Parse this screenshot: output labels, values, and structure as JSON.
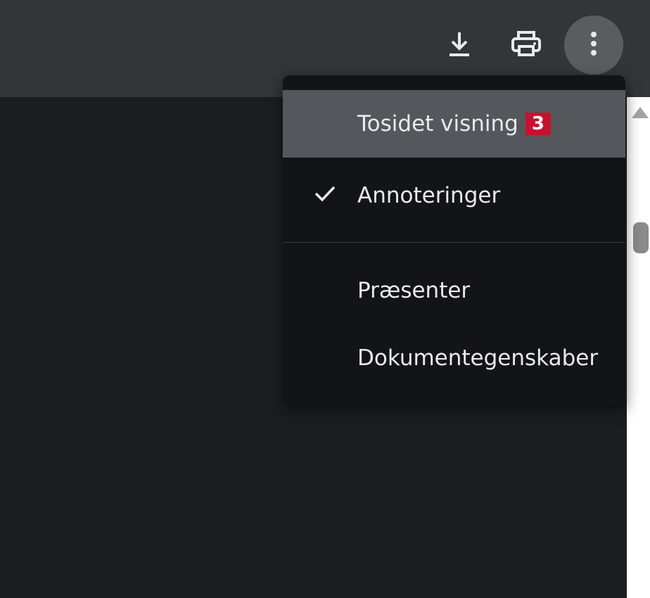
{
  "toolbar": {
    "icons": [
      "download-icon",
      "print-icon",
      "more-vert-icon"
    ]
  },
  "menu": {
    "items": [
      {
        "label": "Tosidet visning",
        "badge": "3"
      },
      {
        "label": "Annoteringer",
        "checked": true
      },
      {
        "label": "Præsenter"
      },
      {
        "label": "Dokumentegenskaber"
      }
    ]
  },
  "colors": {
    "toolbar_bg": "#323639",
    "viewer_bg": "#1b1e20",
    "menu_bg": "#121418",
    "highlight_bg": "#54585d",
    "badge_bg": "#c8102e",
    "text": "#e8eaed"
  }
}
